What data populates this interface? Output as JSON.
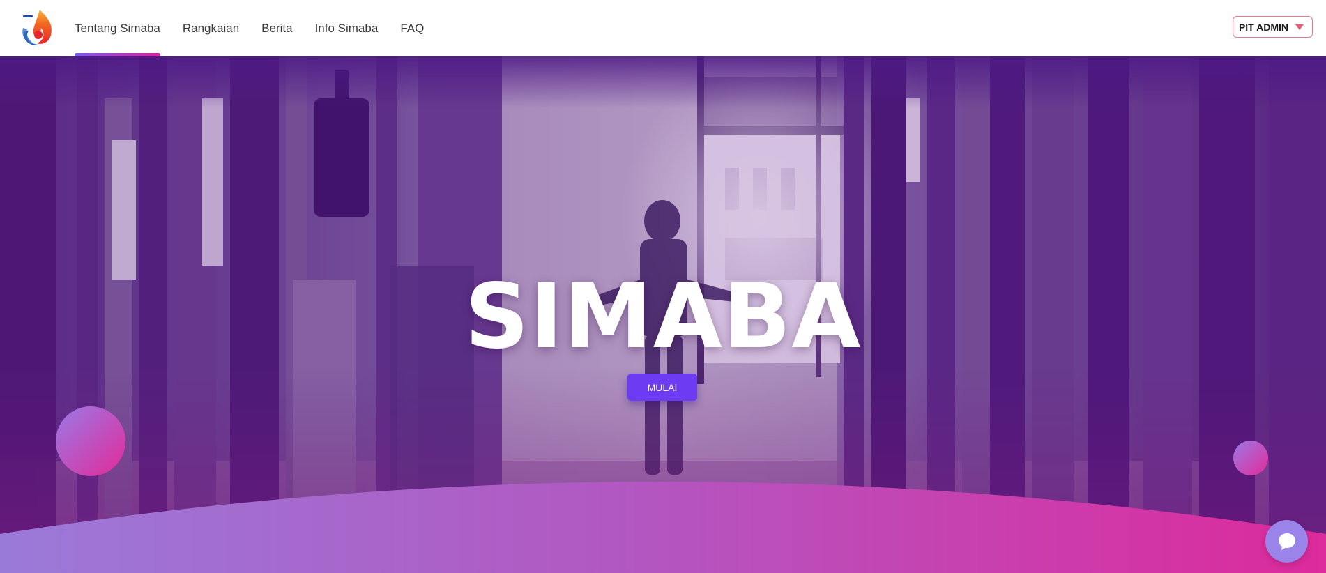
{
  "nav": {
    "logo_icon": "simaba-flame-logo-icon",
    "links": [
      {
        "label": "Tentang Simaba",
        "active": true
      },
      {
        "label": "Rangkaian",
        "active": false
      },
      {
        "label": "Berita",
        "active": false
      },
      {
        "label": "Info Simaba",
        "active": false
      },
      {
        "label": "FAQ",
        "active": false
      }
    ],
    "user_label": "PIT ADMIN",
    "user_menu_icon": "caret-down-icon"
  },
  "hero": {
    "title": "SIMABA",
    "cta_label": "MULAI",
    "background": "purple-tinted-corridor-photo"
  },
  "chat": {
    "icon": "chat-bubble-icon"
  },
  "colors": {
    "accent_purple": "#6d3cf2",
    "gradient_start": "#9a7ae6",
    "gradient_end": "#e32a9a",
    "user_border": "#e87a8a"
  }
}
